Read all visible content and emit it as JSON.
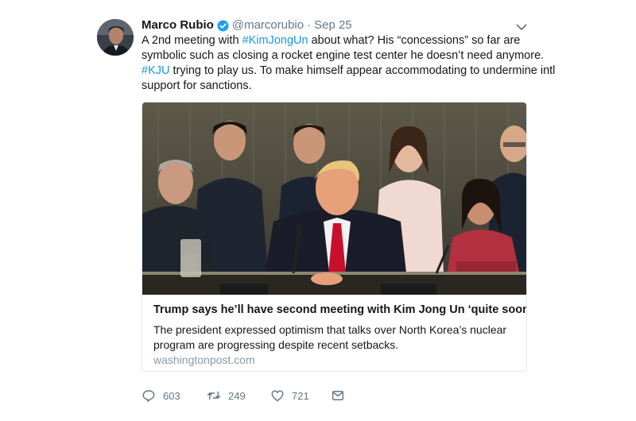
{
  "tweet": {
    "display_name": "Marco Rubio",
    "handle": "@marcorubio",
    "separator": "·",
    "date": "Sep 25",
    "text": {
      "l1_a": "A 2nd meeting with ",
      "l1_tag": "#KimJongUn",
      "l1_b": " about what? His “concessions” so far are",
      "l2": "symbolic such as closing a rocket engine test center he doesn’t need anymore.",
      "l3_tag": "#KJU",
      "l3_b": " trying to play us. To make himself appear accommodating to undermine intl",
      "l4": "support for sanctions."
    }
  },
  "card": {
    "title": "Trump says he’ll have second meeting with Kim Jong Un ‘quite soon’",
    "desc_l1": "The president expressed optimism that talks over North Korea’s nuclear",
    "desc_l2": "program are progressing despite recent setbacks.",
    "domain": "washingtonpost.com"
  },
  "actions": {
    "replies": "603",
    "retweets": "249",
    "likes": "721"
  },
  "icons": [
    "avatar",
    "verified-badge-icon",
    "chevron-down-icon",
    "reply-icon",
    "retweet-icon",
    "like-icon",
    "direct-message-icon"
  ],
  "colors": {
    "link": "#1b95e0",
    "muted": "#657786",
    "text": "#14171a",
    "card_border": "#e1e8ed"
  }
}
